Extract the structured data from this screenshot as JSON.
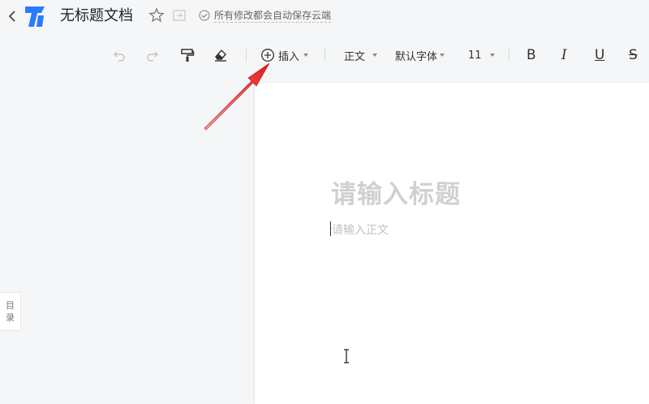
{
  "header": {
    "doc_title": "无标题文档",
    "save_status": "所有修改都会自动保存云端"
  },
  "toolbar": {
    "insert_label": "插入",
    "paragraph_style": "正文",
    "font_family": "默认字体",
    "font_size": "11",
    "bold": "B",
    "italic": "I",
    "underline": "U",
    "strikethrough": "S"
  },
  "sidebar": {
    "toc_label_1": "目",
    "toc_label_2": "录"
  },
  "editor": {
    "title_placeholder": "请输入标题",
    "body_placeholder": "请输入正文"
  },
  "colors": {
    "brand": "#2a7cff",
    "annotation_arrow": "#e02020"
  }
}
